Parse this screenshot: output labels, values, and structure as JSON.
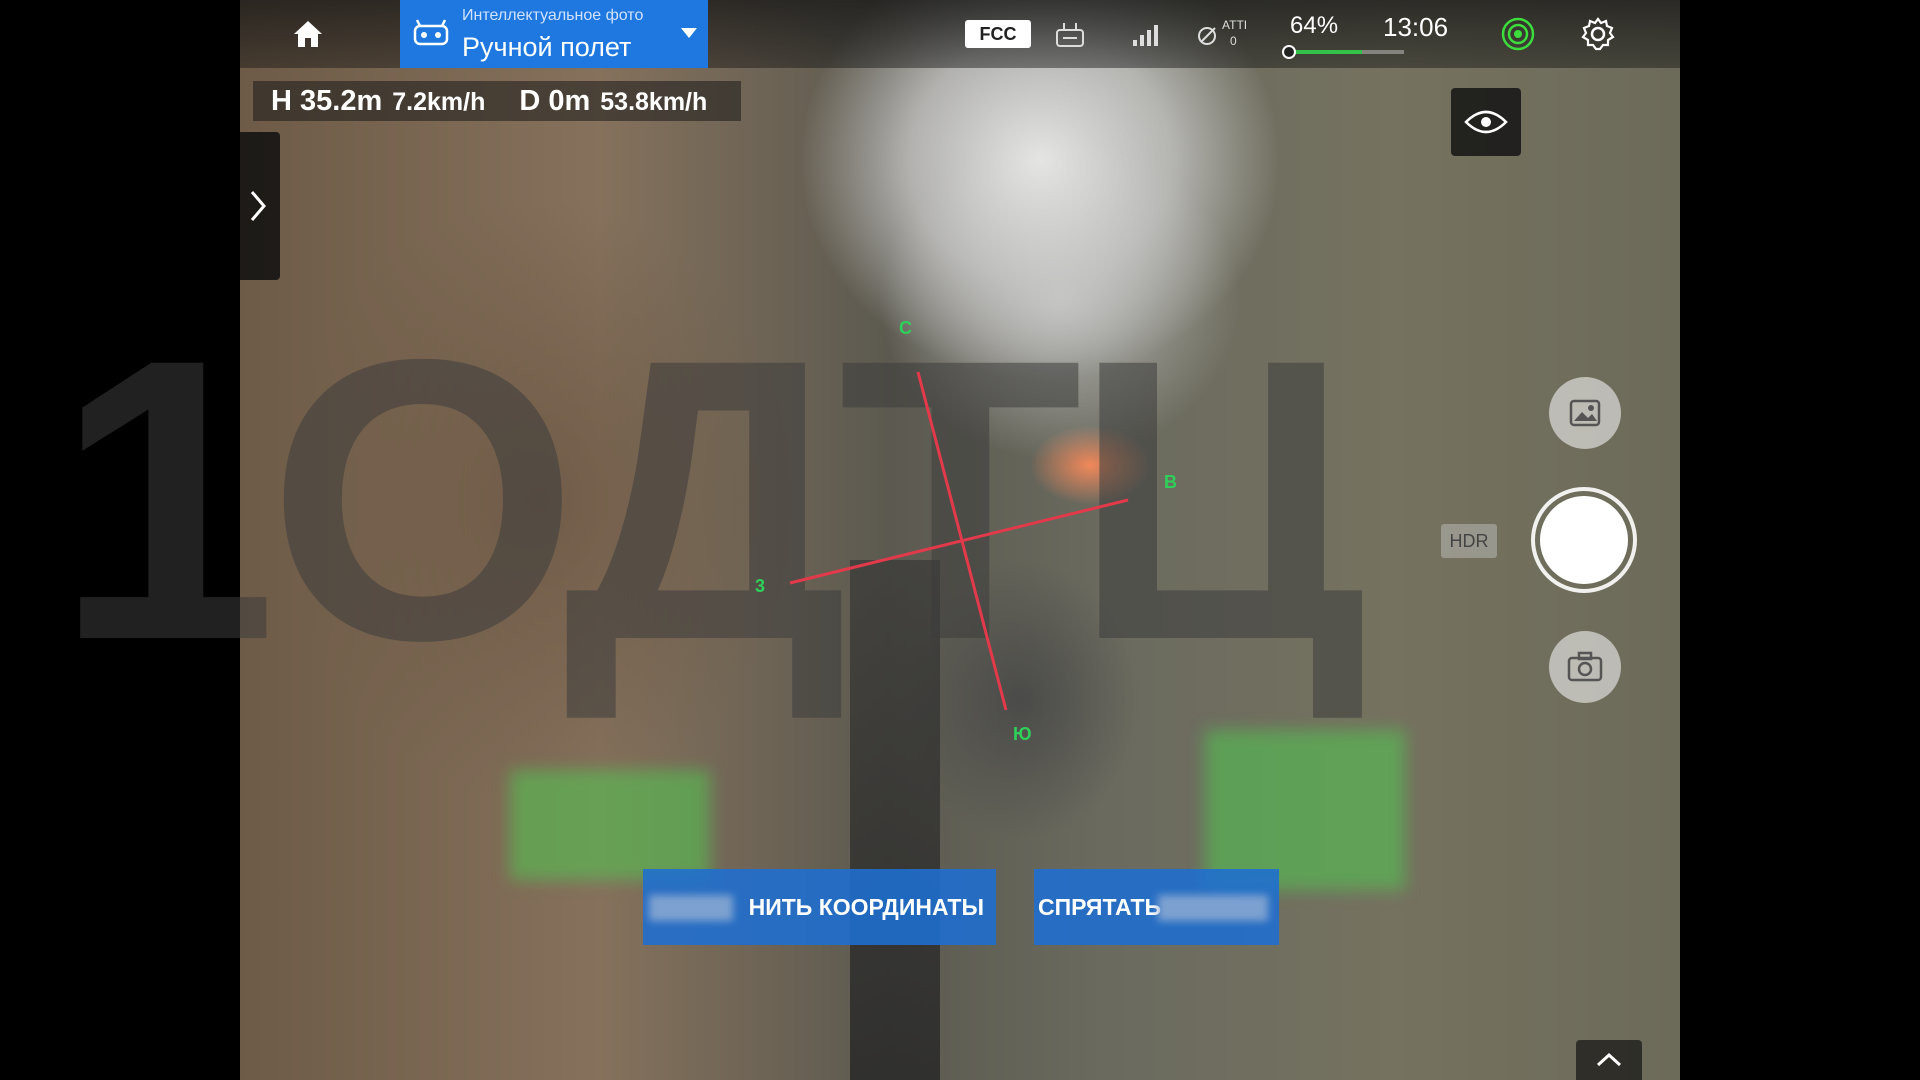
{
  "top_bar": {
    "home_icon": "home-icon",
    "mode": {
      "subtitle": "Интеллектуальное фото",
      "title": "Ручной полет",
      "icon": "drone-controller-icon",
      "caret_icon": "caret-down-icon"
    },
    "fcc_label": "FCC",
    "rc_icon": "remote-controller-icon",
    "signal_icon": "signal-strength-icon",
    "atti": {
      "label": "ATTI",
      "count": "0"
    },
    "battery": {
      "percent_label": "64%",
      "level": 0.64
    },
    "clock": "13:06",
    "gps_icon": "gps-icon",
    "settings_icon": "gear-icon"
  },
  "telemetry": {
    "height": "H 35.2m",
    "vertical_speed": "7.2km/h",
    "distance": "D 0m",
    "horizontal_speed": "53.8km/h"
  },
  "side_panel": {
    "expand_icon": "chevron-right-icon"
  },
  "camera_controls": {
    "view_icon": "eye-icon",
    "gallery_icon": "gallery-icon",
    "hdr_label": "HDR",
    "shutter_icon": "shutter-button",
    "switch_icon": "camera-switch-icon"
  },
  "compass": {
    "left_label": "3",
    "bottom_label": "Ю",
    "top_label": "С",
    "right_label": "В"
  },
  "overlay_buttons": {
    "save_coords": "НИТЬ КООРДИНАТЫ",
    "hide": "СПРЯТАТЬ"
  },
  "watermark": "1ОДТЦ",
  "bottom": {
    "expand_icon": "chevron-up-icon"
  },
  "colors": {
    "accent": "#1e78e0",
    "battery_green": "#33c14a",
    "crosshair_red": "#e23a4a",
    "compass_green": "#2fd05a"
  }
}
